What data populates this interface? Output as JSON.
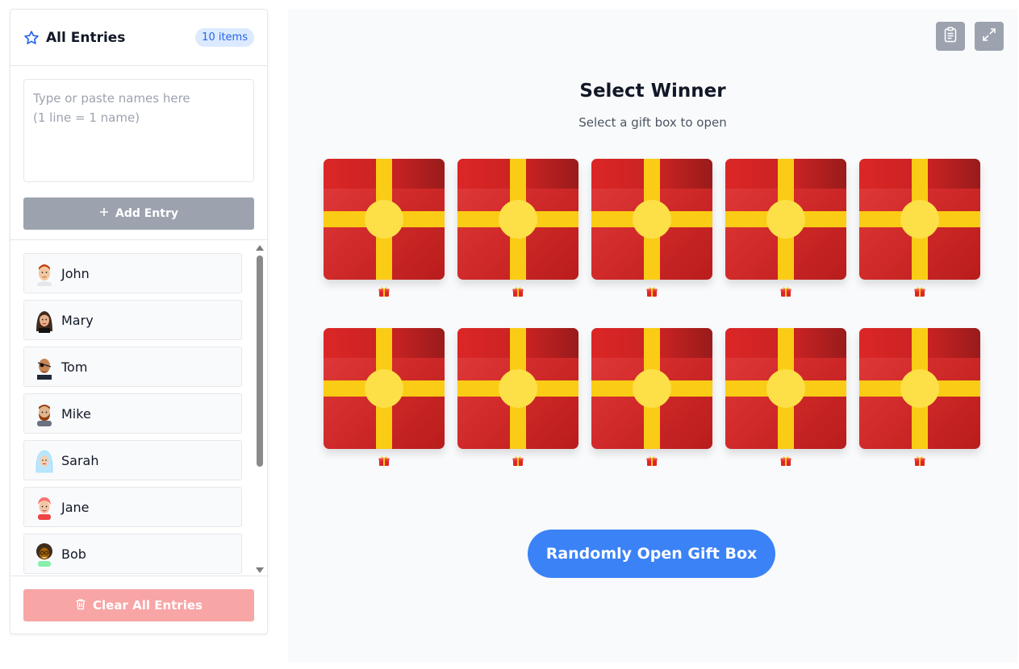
{
  "sidebar": {
    "title": "All Entries",
    "count_badge": "10 items",
    "input_placeholder": "Type or paste names here\n(1 line = 1 name)",
    "input_value": "",
    "add_button_label": "Add Entry",
    "entries": [
      {
        "name": "John",
        "avatar": "avatar-john"
      },
      {
        "name": "Mary",
        "avatar": "avatar-mary"
      },
      {
        "name": "Tom",
        "avatar": "avatar-tom"
      },
      {
        "name": "Mike",
        "avatar": "avatar-mike"
      },
      {
        "name": "Sarah",
        "avatar": "avatar-sarah"
      },
      {
        "name": "Jane",
        "avatar": "avatar-jane"
      },
      {
        "name": "Bob",
        "avatar": "avatar-bob"
      }
    ],
    "clear_button_label": "Clear All Entries"
  },
  "main": {
    "title": "Select Winner",
    "subtitle": "Select a gift box to open",
    "box_count": 10,
    "random_button_label": "Randomly Open Gift Box",
    "top_icons": [
      "clipboard-icon",
      "expand-icon"
    ]
  },
  "colors": {
    "accent_blue": "#3b82f6",
    "badge_bg": "#dbeafe",
    "gift_red": "#dc2626",
    "ribbon_yellow": "#facc15",
    "disabled_gray": "#9ca3af",
    "clear_pink": "#f8a5a5"
  }
}
